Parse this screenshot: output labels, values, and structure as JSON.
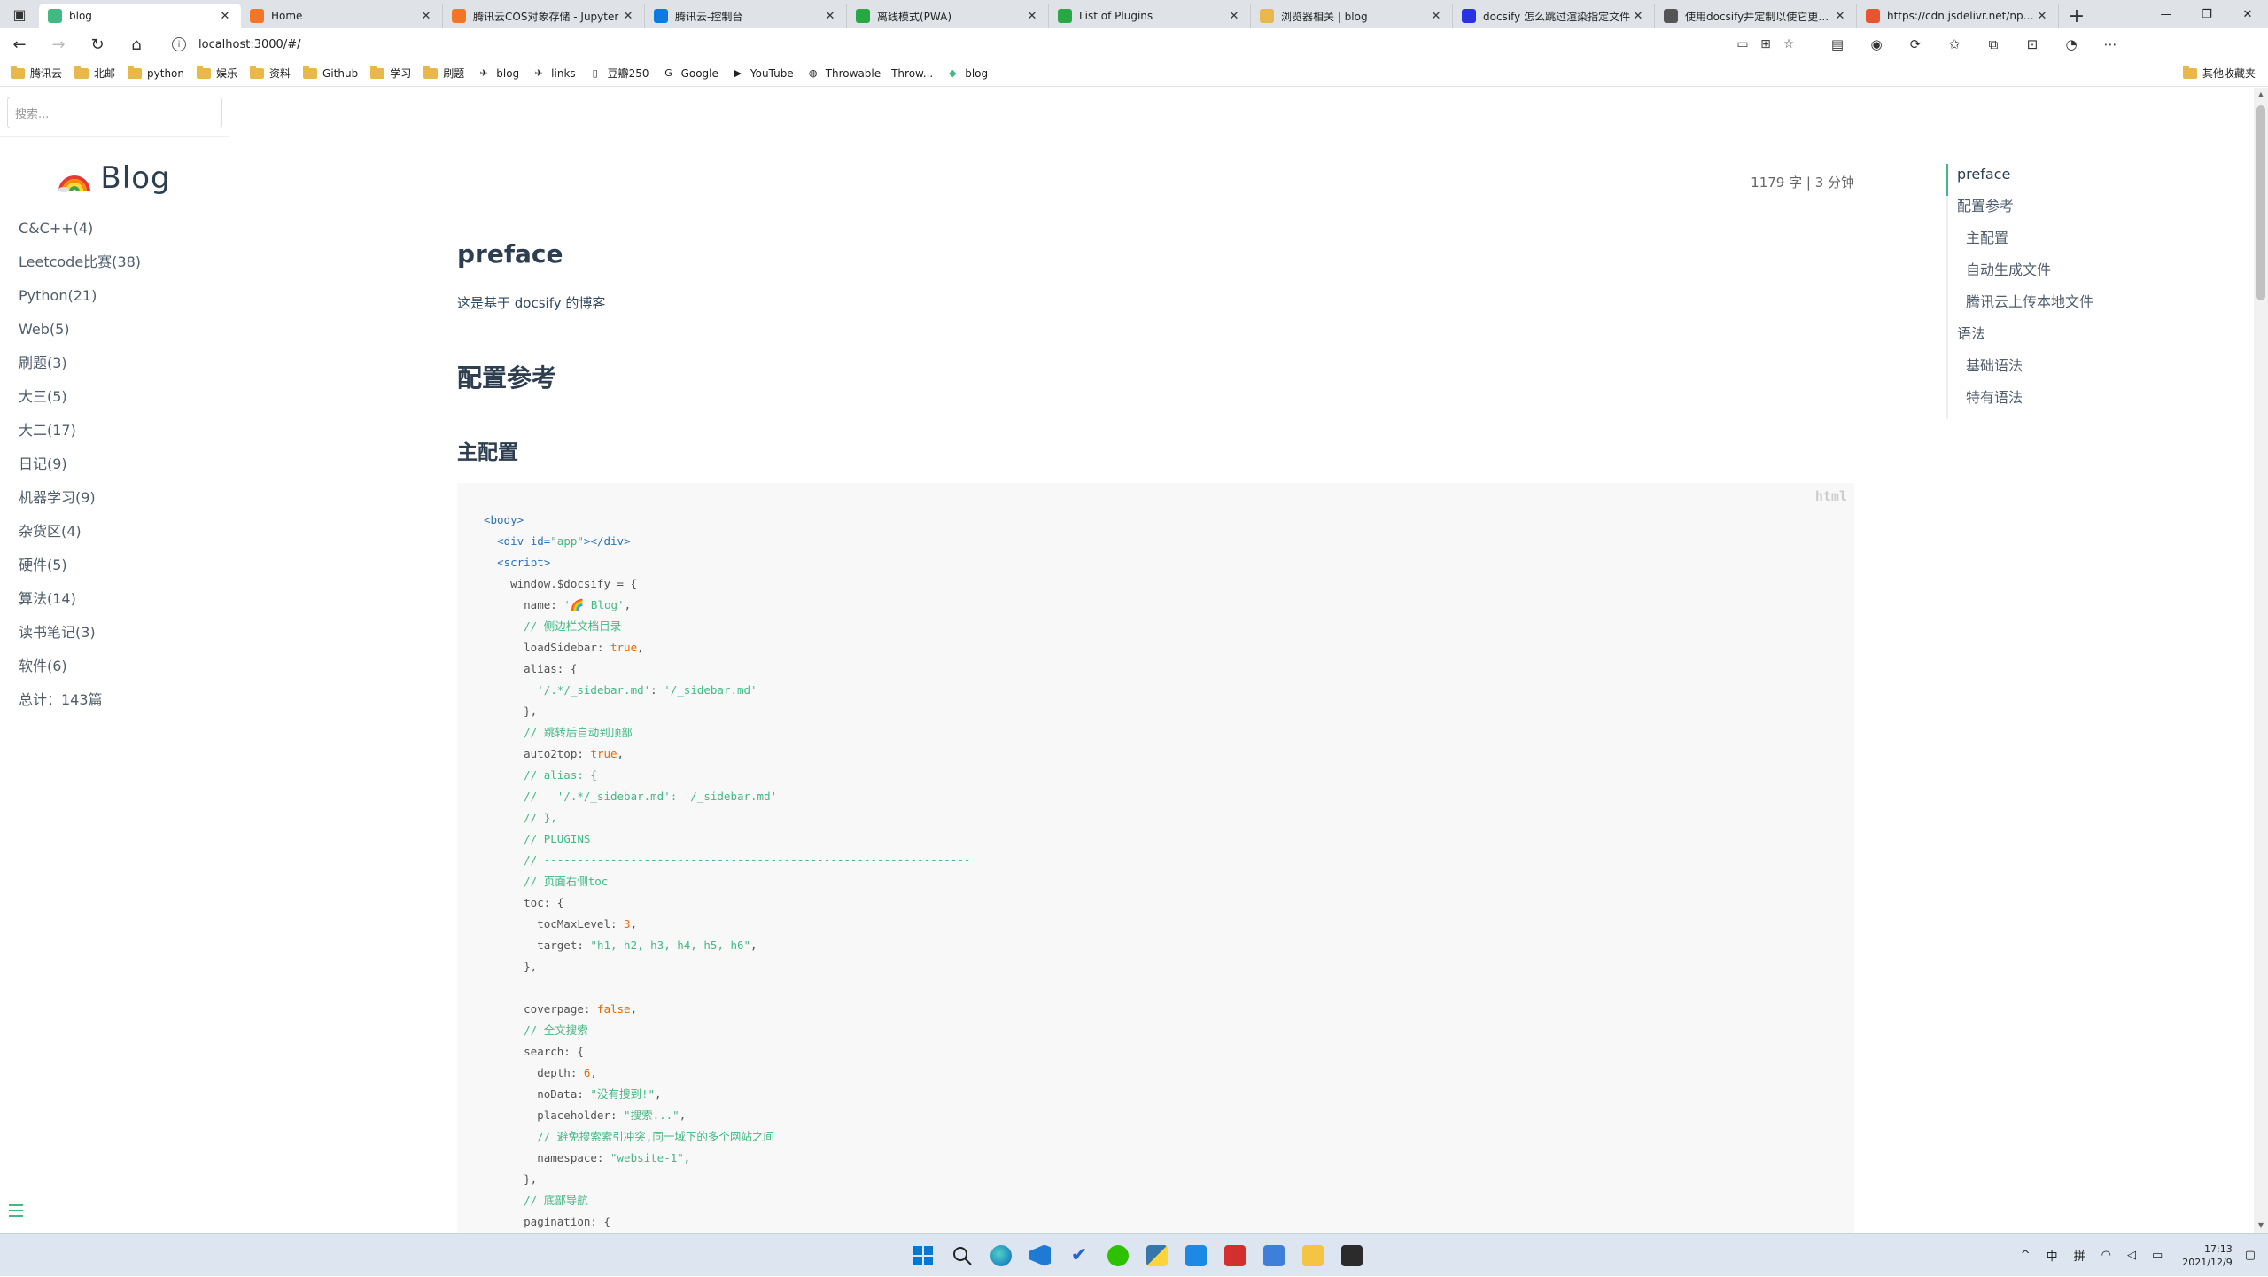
{
  "browser": {
    "tabs": [
      {
        "title": "blog",
        "active": true,
        "color": "#42b983"
      },
      {
        "title": "Home",
        "color": "#f37626"
      },
      {
        "title": "腾讯云COS对象存储 - Jupyter",
        "color": "#f37626"
      },
      {
        "title": "腾讯云-控制台",
        "color": "#0a7be0"
      },
      {
        "title": "离线模式(PWA)",
        "color": "#28a745"
      },
      {
        "title": "List of Plugins",
        "color": "#28a745"
      },
      {
        "title": "浏览器相关 | blog",
        "color": "#e8b84a"
      },
      {
        "title": "docsify 怎么跳过渲染指定文件",
        "color": "#2932e1"
      },
      {
        "title": "使用docsify并定制以使它更强大",
        "color": "#555555"
      },
      {
        "title": "https://cdn.jsdelivr.net/npm/d",
        "color": "#e8542f"
      }
    ],
    "url": "localhost:3000/#/",
    "bookmarks": [
      "腾讯云",
      "北邮",
      "python",
      "娱乐",
      "资料",
      "Github",
      "学习",
      "刷题",
      "blog",
      "links",
      "豆瓣250",
      "Google",
      "YouTube",
      "Throwable - Throw...",
      "blog"
    ],
    "bookmarks_other": "其他收藏夹"
  },
  "sidebar": {
    "search_placeholder": "搜索...",
    "brand": "Blog",
    "items": [
      "C&C++(4)",
      "Leetcode比赛(38)",
      "Python(21)",
      "Web(5)",
      "刷题(3)",
      "大三(5)",
      "大二(17)",
      "日记(9)",
      "机器学习(9)",
      "杂货区(4)",
      "硬件(5)",
      "算法(14)",
      "读书笔记(3)",
      "软件(6)",
      "总计：143篇"
    ]
  },
  "main": {
    "readmeta": "1179 字  |  3 分钟",
    "h1": "preface",
    "p1": "这是基于 docsify 的博客",
    "h2": "配置参考",
    "h3": "主配置",
    "code_lang": "html"
  },
  "toc": [
    {
      "label": "preface",
      "level": 1,
      "active": true
    },
    {
      "label": "配置参考",
      "level": 1
    },
    {
      "label": "主配置",
      "level": 2
    },
    {
      "label": "自动生成文件",
      "level": 2
    },
    {
      "label": "腾讯云上传本地文件",
      "level": 2
    },
    {
      "label": "语法",
      "level": 1
    },
    {
      "label": "基础语法",
      "level": 2
    },
    {
      "label": "特有语法",
      "level": 2
    }
  ],
  "system": {
    "ime_lang": "中",
    "ime_mode": "拼",
    "time": "17:13",
    "date": "2021/12/9"
  },
  "colors": {
    "accent": "#42b983",
    "text": "#34495e",
    "heading": "#2c3e50"
  }
}
